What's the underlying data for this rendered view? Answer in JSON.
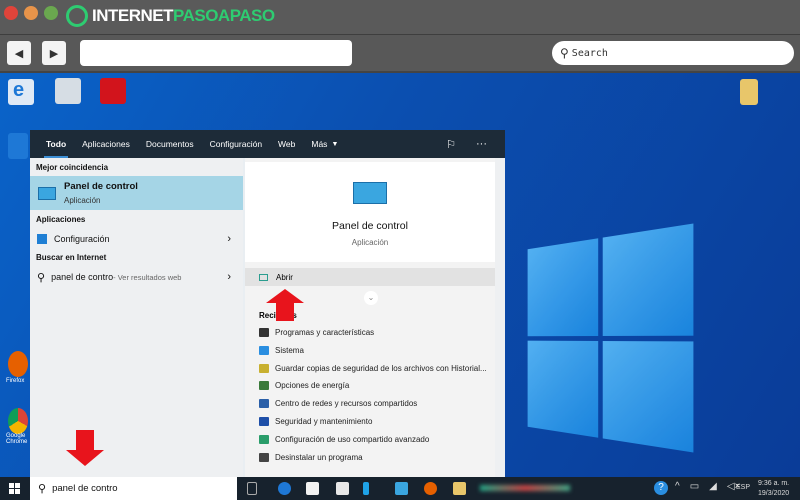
{
  "browser": {
    "logo_text_a": "INTERNET",
    "logo_text_b": "PASOAPASO",
    "search_placeholder": "Search"
  },
  "desktop": {
    "icons": [
      {
        "name": "Internet Explorer"
      },
      {
        "name": "Recycle Bin"
      },
      {
        "name": "Adobe Creative Cloud"
      },
      {
        "name": "Folder"
      }
    ],
    "left_labels": [
      "Firefox",
      "Google Chrome"
    ]
  },
  "start": {
    "tabs": [
      "Todo",
      "Aplicaciones",
      "Documentos",
      "Configuración",
      "Web",
      "Más"
    ],
    "best_header": "Mejor coincidencia",
    "best": {
      "title": "Panel de control",
      "subtitle": "Aplicación"
    },
    "apps_header": "Aplicaciones",
    "apps": [
      {
        "label": "Configuración"
      }
    ],
    "web_header": "Buscar en Internet",
    "web": {
      "query": "panel de contro",
      "suffix": " - Ver resultados web"
    },
    "preview": {
      "title": "Panel de control",
      "subtitle": "Aplicación",
      "open": "Abrir",
      "recent_header": "Recientes"
    },
    "recent": [
      "Programas y características",
      "Sistema",
      "Guardar copias de seguridad de los archivos con Historial...",
      "Opciones de energía",
      "Centro de redes y recursos compartidos",
      "Seguridad y mantenimiento",
      "Configuración de uso compartido avanzado",
      "Desinstalar un programa"
    ]
  },
  "taskbar": {
    "search_value": "panel de contro",
    "time": "9:36 a. m.",
    "date": "19/3/2020",
    "lang": "ESP"
  },
  "colors": {
    "highlight": "#a5d5e6",
    "arrow": "#e8141c",
    "taskbar": "#17222d",
    "tabbar": "#1d2b38"
  }
}
